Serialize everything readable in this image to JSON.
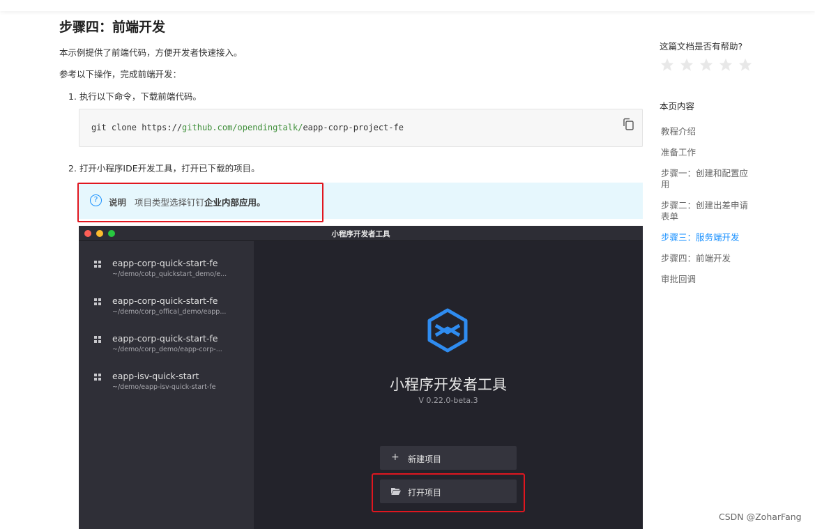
{
  "article": {
    "heading": "步骤四：前端开发",
    "intro": "本示例提供了前端代码，方便开发者快速接入。",
    "instruction": "参考以下操作，完成前端开发：",
    "step1": "1. 执行以下命令，下载前端代码。",
    "code": {
      "prefix": "git clone https://",
      "host": "github.com/",
      "org": "opendingtalk/",
      "repo": "eapp-corp-project-fe"
    },
    "step2": "2. 打开小程序IDE开发工具，打开已下载的项目。",
    "note": {
      "title": "说明",
      "text_prefix": "项目类型选择钉钉",
      "text_bold": "企业内部应用。"
    }
  },
  "ide": {
    "window_title": "小程序开发者工具",
    "projects": [
      {
        "name": "eapp-corp-quick-start-fe",
        "path": "~/demo/cotp_quickstart_demo/e..."
      },
      {
        "name": "eapp-corp-quick-start-fe",
        "path": "~/demo/corp_offical_demo/eapp..."
      },
      {
        "name": "eapp-corp-quick-start-fe",
        "path": "~/demo/corp_demo/eapp-corp-..."
      },
      {
        "name": "eapp-isv-quick-start",
        "path": "~/demo/eapp-isv-quick-start-fe"
      }
    ],
    "app_name": "小程序开发者工具",
    "version": "V 0.22.0-beta.3",
    "new_project_label": "新建项目",
    "open_project_label": "打开项目"
  },
  "sidebar": {
    "help_question": "这篇文档是否有帮助?",
    "rating": {
      "value": 0,
      "max": 5
    },
    "toc_title": "本页内容",
    "toc": [
      {
        "label": "教程介绍",
        "active": false
      },
      {
        "label": "准备工作",
        "active": false
      },
      {
        "label": "步骤一：创建和配置应用",
        "active": false
      },
      {
        "label": "步骤二：创建出差申请表单",
        "active": false
      },
      {
        "label": "步骤三：服务端开发",
        "active": true
      },
      {
        "label": "步骤四：前端开发",
        "active": false
      },
      {
        "label": "审批回调",
        "active": false
      }
    ]
  },
  "watermark": "CSDN @ZoharFang",
  "colors": {
    "accent": "#1890ff",
    "highlight_border": "#e0161f",
    "note_bg": "#e6f7fd",
    "ide_bg": "#23232b",
    "ide_sidebar": "#2f2f37"
  }
}
